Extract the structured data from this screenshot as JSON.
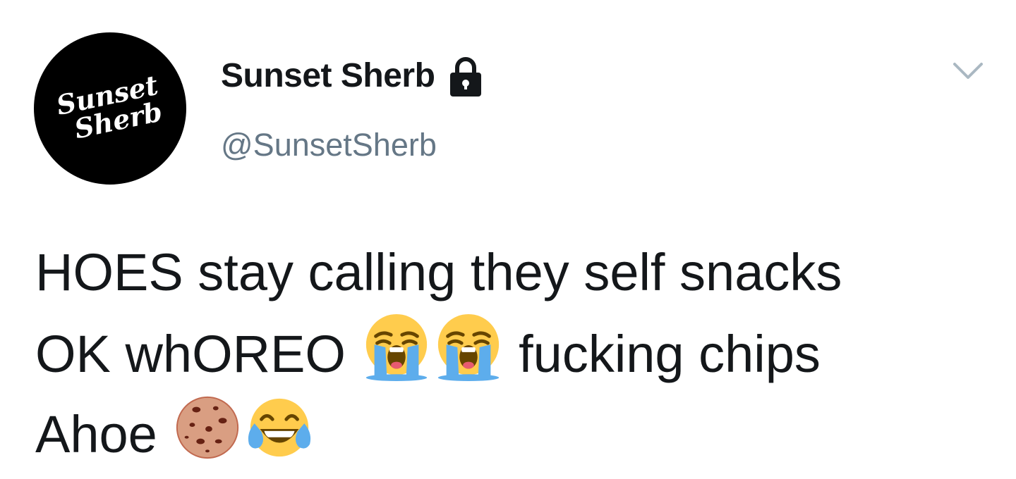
{
  "tweet": {
    "avatar": {
      "logo_line1": "Sunset",
      "logo_line2": "Sherb"
    },
    "display_name": "Sunset Sherb",
    "handle": "@SunsetSherb",
    "protected_icon": "lock-icon",
    "menu_icon": "chevron-down-icon",
    "text": {
      "line1": "HOES stay calling they self snacks",
      "line2_part1": "OK whOREO",
      "line2_part2": "fucking chips",
      "line3_part1": "Ahoe"
    },
    "emojis": [
      "loudly-crying-face",
      "loudly-crying-face",
      "cookie",
      "face-with-tears-of-joy"
    ]
  },
  "colors": {
    "text": "#14171a",
    "handle": "#657786",
    "caret": "#aab8c2",
    "avatar_bg": "#000000"
  }
}
